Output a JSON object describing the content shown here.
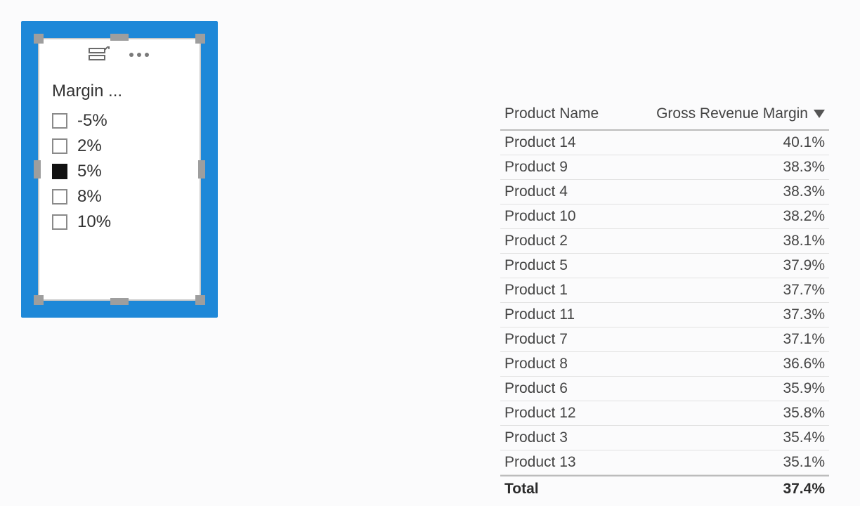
{
  "slicer": {
    "title": "Margin ...",
    "items": [
      {
        "label": "-5%",
        "checked": false
      },
      {
        "label": "2%",
        "checked": false
      },
      {
        "label": "5%",
        "checked": true
      },
      {
        "label": "8%",
        "checked": false
      },
      {
        "label": "10%",
        "checked": false
      }
    ]
  },
  "table": {
    "columns": {
      "name": "Product Name",
      "value": "Gross Revenue Margin"
    },
    "rows": [
      {
        "name": "Product 14",
        "value": "40.1%"
      },
      {
        "name": "Product 9",
        "value": "38.3%"
      },
      {
        "name": "Product 4",
        "value": "38.3%"
      },
      {
        "name": "Product 10",
        "value": "38.2%"
      },
      {
        "name": "Product 2",
        "value": "38.1%"
      },
      {
        "name": "Product 5",
        "value": "37.9%"
      },
      {
        "name": "Product 1",
        "value": "37.7%"
      },
      {
        "name": "Product 11",
        "value": "37.3%"
      },
      {
        "name": "Product 7",
        "value": "37.1%"
      },
      {
        "name": "Product 8",
        "value": "36.6%"
      },
      {
        "name": "Product 6",
        "value": "35.9%"
      },
      {
        "name": "Product 12",
        "value": "35.8%"
      },
      {
        "name": "Product 3",
        "value": "35.4%"
      },
      {
        "name": "Product 13",
        "value": "35.1%"
      }
    ],
    "total": {
      "label": "Total",
      "value": "37.4%"
    }
  }
}
